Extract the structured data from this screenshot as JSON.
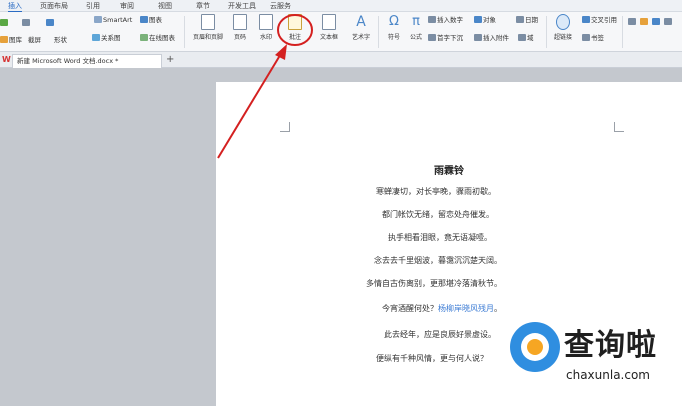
{
  "menubar": {
    "tabs": [
      "插入",
      "页面布局",
      "引用",
      "审阅",
      "视图",
      "章节",
      "开发工具",
      "云服务"
    ]
  },
  "ribbon": {
    "left_items": [
      "图库",
      "截屏",
      "形状",
      "SmartArt",
      "关系图",
      "图表",
      "在线图表"
    ],
    "big_buttons": [
      "页眉和页脚",
      "页码",
      "水印",
      "批注",
      "文本框",
      "艺术字",
      "符号",
      "公式"
    ],
    "small_items": [
      "插入数字",
      "对象",
      "日期",
      "首字下沉",
      "插入附件",
      "域",
      "超链接",
      "交叉引用",
      "书签"
    ]
  },
  "doc_tab": {
    "title": "新建 Microsoft Word 文档.docx *",
    "add_label": "+"
  },
  "document": {
    "title": "雨霖铃",
    "lines": [
      "寒蝉凄切，对长亭晚，骤雨初歇。",
      "都门帐饮无绪，留恋处舟催发。",
      "执手相看泪眼，竟无语凝噎。",
      "念去去千里烟波，暮霭沉沉楚天阔。",
      "多情自古伤离别，更那堪冷落清秋节。",
      "今宵酒醒何处？杨柳岸晓风残月。",
      "此去经年，应是良辰好景虚设。",
      "便纵有千种风情，更与何人说？"
    ],
    "highlight_text": "杨柳岸晓风残月"
  },
  "watermark": {
    "cn": "查询啦",
    "en": "chaxunla.com"
  },
  "colors": {
    "accent": "#2b6cc4",
    "annotation": "#d42020",
    "highlight": "#3b7bd4"
  }
}
